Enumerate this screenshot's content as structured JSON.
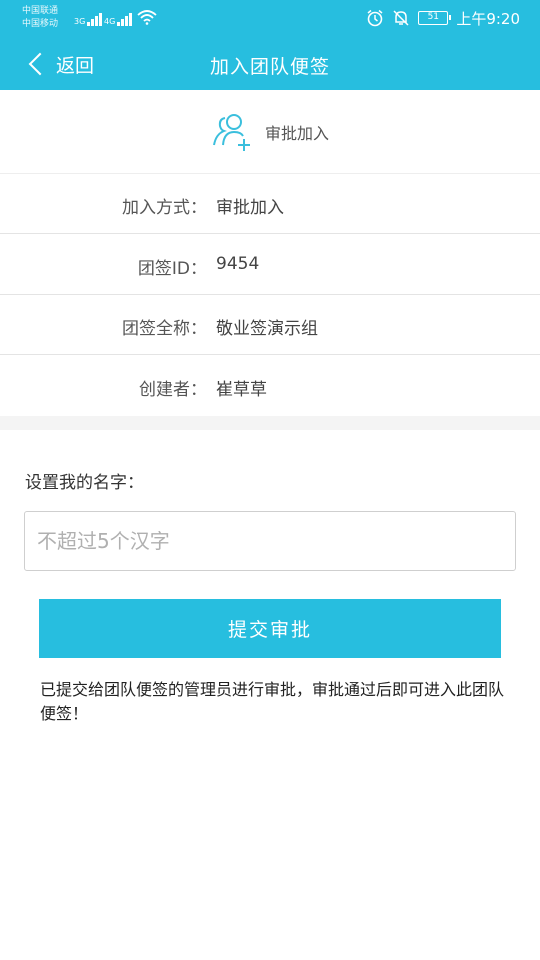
{
  "status_bar": {
    "carrier_1": "中国联通",
    "carrier_2": "中国移动",
    "network_1": "3G",
    "network_2": "4G",
    "battery": "51",
    "time": "上午9:20",
    "icons": [
      "signal-icon",
      "wifi-icon",
      "alarm-icon",
      "mute-icon",
      "battery-icon"
    ]
  },
  "navbar": {
    "back_label": "返回",
    "title": "加入团队便签"
  },
  "join_banner": {
    "icon": "add-user-icon",
    "label": "审批加入"
  },
  "info_rows": [
    {
      "label": "加入方式：",
      "value": "审批加入"
    },
    {
      "label": "团签ID：",
      "value": "9454"
    },
    {
      "label": "团签全称：",
      "value": "敬业签演示组"
    },
    {
      "label": "创建者：",
      "value": "崔草草"
    }
  ],
  "name_section": {
    "label": "设置我的名字：",
    "placeholder": "不超过5个汉字",
    "value": ""
  },
  "submit_label": "提交审批",
  "note": "已提交给团队便签的管理员进行审批，审批通过后即可进入此团队便签！",
  "colors": {
    "accent": "#27bedf",
    "icon": "#3bbfdd"
  }
}
